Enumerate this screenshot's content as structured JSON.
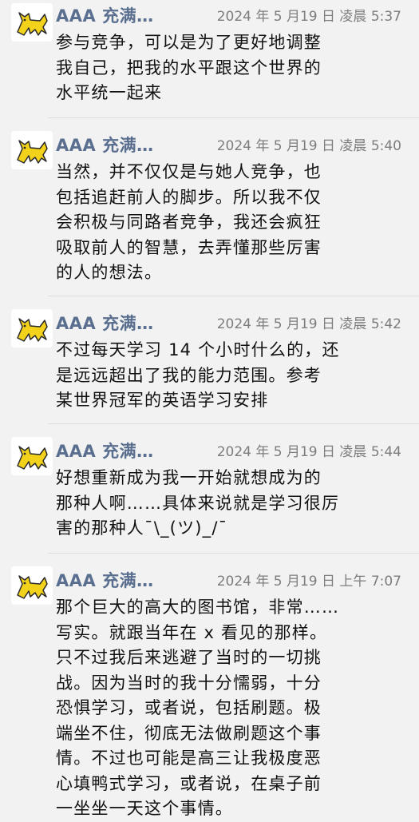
{
  "messages": [
    {
      "sender": "AAA 充满…",
      "time": "2024 年 5 月19 日 凌晨 5:37",
      "text": "参与竞争，可以是为了更好地调整\n我自己，把我的水平跟这个世界的\n水平统一起来"
    },
    {
      "sender": "AAA 充满…",
      "time": "2024 年 5 月19 日 凌晨 5:40",
      "text": "当然，并不仅仅是与她人竞争，也\n包括追赶前人的脚步。所以我不仅\n会积极与同路者竞争，我还会疯狂\n吸取前人的智慧，去弄懂那些厉害\n的人的想法。"
    },
    {
      "sender": "AAA 充满…",
      "time": "2024 年 5 月19 日 凌晨 5:42",
      "text": "不过每天学习 14 个小时什么的，还\n是远远超出了我的能力范围。参考\n某世界冠军的英语学习安排"
    },
    {
      "sender": "AAA 充满…",
      "time": "2024 年 5 月19 日 凌晨 5:44",
      "text": "好想重新成为我一开始就想成为的\n那种人啊……具体来说就是学习很厉\n害的那种人¯\\_(ツ)_/¯"
    },
    {
      "sender": "AAA 充满…",
      "time": "2024 年 5 月19 日 上午 7:07",
      "text": "那个巨大的高大的图书馆，非常……\n写实。就跟当年在 x 看见的那样。\n只不过我后来逃避了当时的一切挑\n战。因为当时的我十分懦弱，十分\n恐惧学习，或者说，包括刷题。极\n端坐不住，彻底无法做刷题这个事\n情。不过也可能是高三让我极度恶\n心填鸭式学习，或者说，在桌子前\n一坐坐一天这个事情。"
    }
  ],
  "avatar_icon": "yellow-cat-icon",
  "colors": {
    "sender": "#5a6f8f",
    "time": "#7d7d7d",
    "text": "#111111",
    "background": "#f2f2f2",
    "avatar_cat": "#f3d21c"
  }
}
